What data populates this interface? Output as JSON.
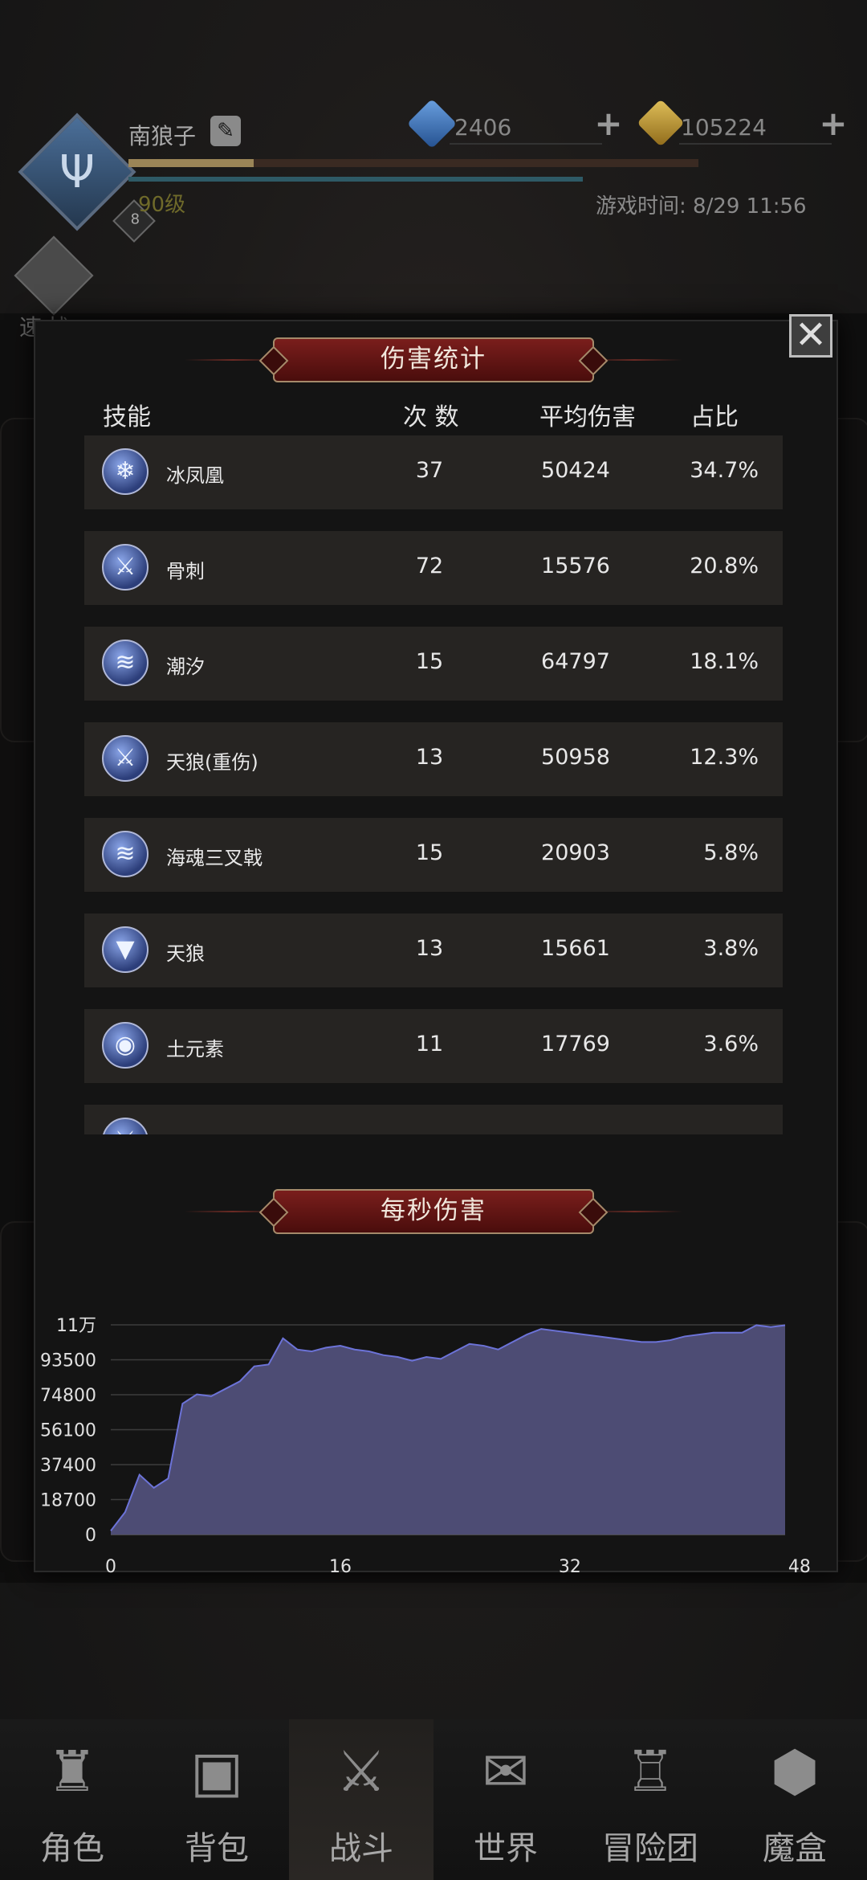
{
  "header": {
    "player_name": "南狼子",
    "level_text": "90级",
    "avatar_level": "8",
    "gems": "2406",
    "gold": "105224",
    "game_time": "游戏时间: 8/29 11:56",
    "xp_fraction": 0.22,
    "speed_battle_label": "速战"
  },
  "damage_stats": {
    "title": "伤害统计",
    "columns": {
      "skill": "技能",
      "count": "次 数",
      "avg": "平均伤害",
      "pct": "占比"
    },
    "rows": [
      {
        "icon": "ice-phoenix-icon",
        "glyph": "❄",
        "name": "冰凤凰",
        "count": "37",
        "avg": "50424",
        "pct": "34.7%"
      },
      {
        "icon": "sword-icon",
        "glyph": "⚔",
        "name": "骨刺",
        "count": "72",
        "avg": "15576",
        "pct": "20.8%"
      },
      {
        "icon": "wave-icon",
        "glyph": "≋",
        "name": "潮汐",
        "count": "15",
        "avg": "64797",
        "pct": "18.1%"
      },
      {
        "icon": "sword-icon",
        "glyph": "⚔",
        "name": "天狼(重伤)",
        "count": "13",
        "avg": "50958",
        "pct": "12.3%"
      },
      {
        "icon": "wave-icon",
        "glyph": "≋",
        "name": "海魂三叉戟",
        "count": "15",
        "avg": "20903",
        "pct": "5.8%"
      },
      {
        "icon": "wolf-fang-icon",
        "glyph": "▼",
        "name": "天狼",
        "count": "13",
        "avg": "15661",
        "pct": "3.8%"
      },
      {
        "icon": "earth-elemental-icon",
        "glyph": "◉",
        "name": "土元素",
        "count": "11",
        "avg": "17769",
        "pct": "3.6%"
      },
      {
        "icon": "sword-icon",
        "glyph": "⚔",
        "name": "",
        "count": "",
        "avg": "",
        "pct": ""
      }
    ]
  },
  "dps": {
    "title": "每秒伤害"
  },
  "chart_data": {
    "type": "area",
    "title": "每秒伤害",
    "xlabel": "",
    "ylabel": "",
    "x_ticks": [
      "0",
      "16",
      "32",
      "48"
    ],
    "y_ticks": [
      "0",
      "18700",
      "37400",
      "56100",
      "74800",
      "93500",
      "11万"
    ],
    "xlim": [
      0,
      47
    ],
    "ylim": [
      0,
      112200
    ],
    "grid": true,
    "series": [
      {
        "color": "#4d4c74",
        "x": [
          0,
          1,
          2,
          3,
          4,
          5,
          6,
          7,
          8,
          9,
          10,
          11,
          12,
          13,
          14,
          15,
          16,
          17,
          18,
          19,
          20,
          21,
          22,
          23,
          24,
          25,
          26,
          27,
          28,
          29,
          30,
          31,
          32,
          33,
          34,
          35,
          36,
          37,
          38,
          39,
          40,
          41,
          42,
          43,
          44,
          45,
          46,
          47
        ],
        "y": [
          2000,
          12000,
          32000,
          25000,
          30000,
          70000,
          75000,
          74000,
          78000,
          82000,
          90000,
          91000,
          105000,
          99000,
          98000,
          100000,
          101000,
          99000,
          98000,
          96000,
          95000,
          93000,
          95000,
          94000,
          98000,
          102000,
          101000,
          99000,
          103000,
          107000,
          110000,
          109000,
          108000,
          107000,
          106000,
          105000,
          104000,
          103000,
          103000,
          104000,
          106000,
          107000,
          108000,
          108000,
          108000,
          112000,
          111000,
          112000
        ]
      }
    ]
  },
  "nav": {
    "items": [
      {
        "label": "角色",
        "icon": "helmet-icon",
        "glyph": "♜",
        "active": false
      },
      {
        "label": "背包",
        "icon": "backpack-icon",
        "glyph": "▣",
        "active": false
      },
      {
        "label": "战斗",
        "icon": "sword-shield-icon",
        "glyph": "⚔",
        "active": true
      },
      {
        "label": "世界",
        "icon": "map-scroll-icon",
        "glyph": "✉",
        "active": false
      },
      {
        "label": "冒险团",
        "icon": "castle-icon",
        "glyph": "♖",
        "active": false
      },
      {
        "label": "魔盒",
        "icon": "magic-cube-icon",
        "glyph": "⬢",
        "active": false
      }
    ]
  }
}
